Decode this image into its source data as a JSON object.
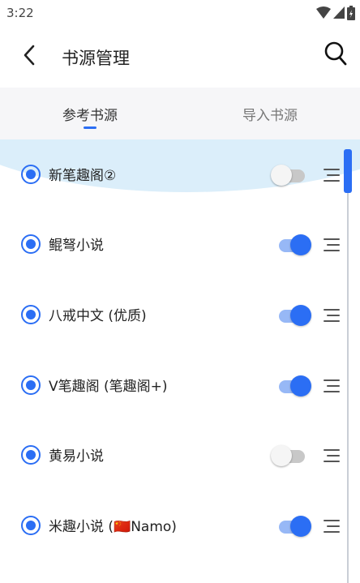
{
  "status_bar": {
    "time": "3:22"
  },
  "header": {
    "title": "书源管理"
  },
  "tabs": [
    {
      "label": "参考书源",
      "active": true
    },
    {
      "label": "导入书源",
      "active": false
    }
  ],
  "sources": [
    {
      "label": "新笔趣阁②",
      "selected": true,
      "enabled": false
    },
    {
      "label": "鲲弩小说",
      "selected": true,
      "enabled": true
    },
    {
      "label": "八戒中文 (优质)",
      "selected": true,
      "enabled": true
    },
    {
      "label": "V笔趣阁 (笔趣阁+)",
      "selected": true,
      "enabled": true
    },
    {
      "label": "黄易小说",
      "selected": true,
      "enabled": false
    },
    {
      "label": "米趣小说 (🇨🇳Namo)",
      "selected": true,
      "enabled": true
    }
  ],
  "icons": {
    "back": "chevron-left-icon",
    "search": "search-icon",
    "drag": "drag-handle-icon",
    "wifi": "wifi-icon",
    "signal": "signal-icon",
    "battery": "battery-icon"
  },
  "colors": {
    "accent": "#2b6ef4",
    "switch_on_track": "#97b8f6",
    "switch_off_track": "#c8c8c8",
    "header_band": "#dbeefa",
    "tab_background": "#f6f6f8"
  }
}
